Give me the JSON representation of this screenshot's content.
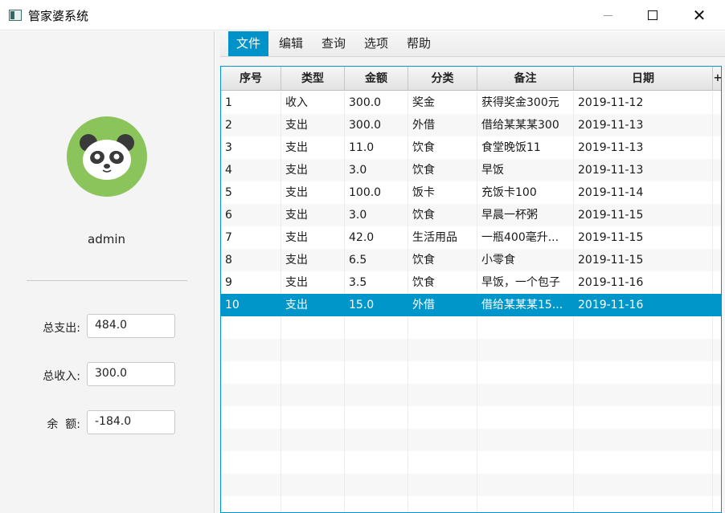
{
  "window": {
    "title": "管家婆系统",
    "close_glyph": "✕"
  },
  "sidebar": {
    "username": "admin",
    "stats": [
      {
        "label": "总支出:",
        "value": "484.0"
      },
      {
        "label": "总收入:",
        "value": "300.0"
      },
      {
        "label": "余  额:",
        "value": "-184.0"
      }
    ]
  },
  "menu": {
    "items": [
      "文件",
      "编辑",
      "查询",
      "选项",
      "帮助"
    ],
    "active_index": 0
  },
  "table": {
    "columns": [
      "序号",
      "类型",
      "金额",
      "分类",
      "备注",
      "日期"
    ],
    "menu_button": "+",
    "rows": [
      [
        "1",
        "收入",
        "300.0",
        "奖金",
        "获得奖金300元",
        "2019-11-12"
      ],
      [
        "2",
        "支出",
        "300.0",
        "外借",
        "借给某某某300",
        "2019-11-13"
      ],
      [
        "3",
        "支出",
        "11.0",
        "饮食",
        "食堂晚饭11",
        "2019-11-13"
      ],
      [
        "4",
        "支出",
        "3.0",
        "饮食",
        "早饭",
        "2019-11-13"
      ],
      [
        "5",
        "支出",
        "100.0",
        "饭卡",
        "充饭卡100",
        "2019-11-14"
      ],
      [
        "6",
        "支出",
        "3.0",
        "饮食",
        "早晨一杯粥",
        "2019-11-15"
      ],
      [
        "7",
        "支出",
        "42.0",
        "生活用品",
        "一瓶400毫升...",
        "2019-11-15"
      ],
      [
        "8",
        "支出",
        "6.5",
        "饮食",
        "小零食",
        "2019-11-15"
      ],
      [
        "9",
        "支出",
        "3.5",
        "饮食",
        "早饭，一个包子",
        "2019-11-16"
      ],
      [
        "10",
        "支出",
        "15.0",
        "外借",
        "借给某某某15...",
        "2019-11-16"
      ]
    ],
    "selected_index": 9
  },
  "colors": {
    "accent": "#0096c9",
    "avatar_bg": "#8bc45a"
  },
  "icons": {
    "avatar": "panda-icon",
    "app": "app-icon",
    "minimize": "minimize-icon",
    "maximize": "maximize-icon",
    "close": "close-icon"
  }
}
